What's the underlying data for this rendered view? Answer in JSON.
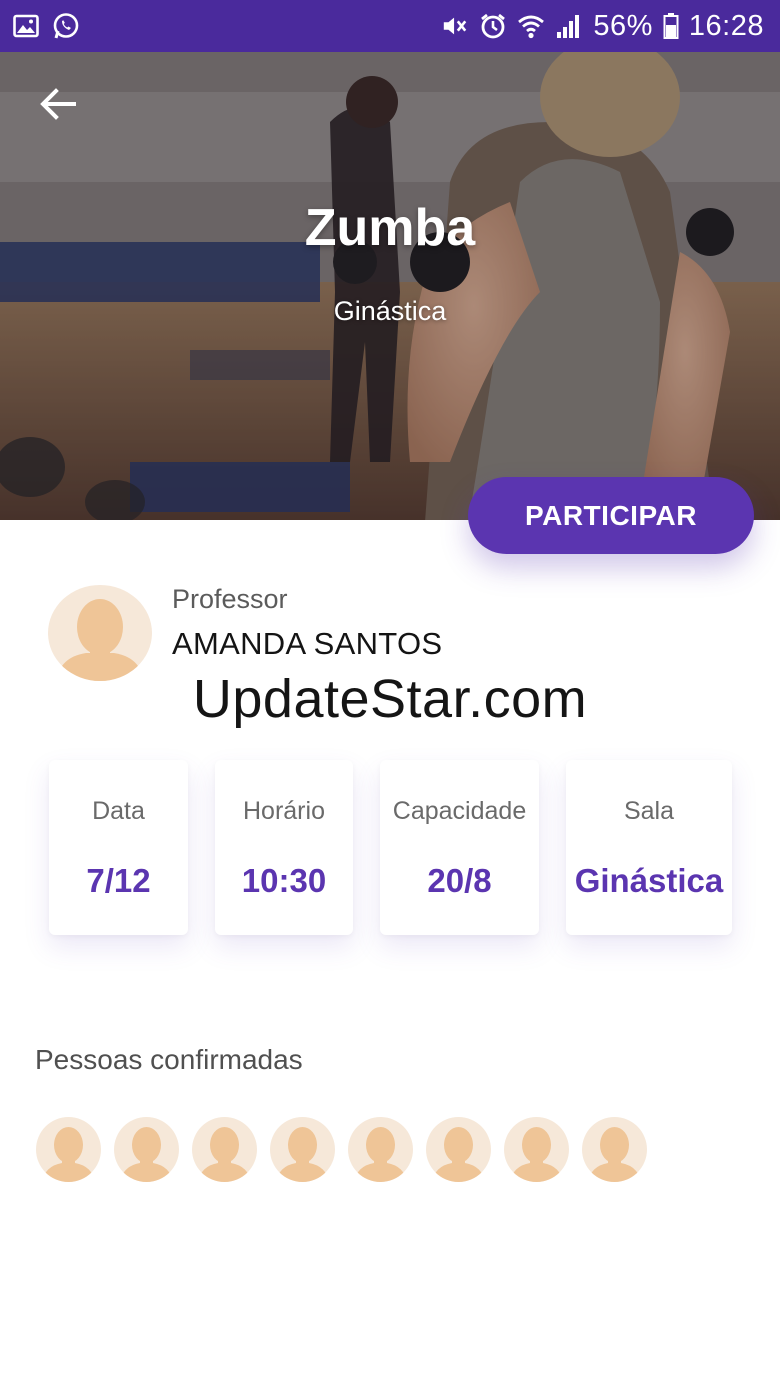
{
  "status_bar": {
    "battery": "56%",
    "time": "16:28",
    "icons": [
      "image-icon",
      "whatsapp-icon",
      "mute-icon",
      "alarm-icon",
      "wifi-icon",
      "signal-icon",
      "battery-icon"
    ],
    "background": "#4a2a9c"
  },
  "hero": {
    "title": "Zumba",
    "subtitle": "Ginástica"
  },
  "actions": {
    "participar_label": "PARTICIPAR",
    "accent": "#5b35b0"
  },
  "professor": {
    "label": "Professor",
    "name": "AMANDA SANTOS"
  },
  "watermark": "UpdateStar.com",
  "info_cards": [
    {
      "label": "Data",
      "value": "7/12"
    },
    {
      "label": "Horário",
      "value": "10:30"
    },
    {
      "label": "Capacidade",
      "value": "20/8"
    },
    {
      "label": "Sala",
      "value": "Ginástica"
    }
  ],
  "confirmed": {
    "title": "Pessoas confirmadas",
    "count": 8
  }
}
